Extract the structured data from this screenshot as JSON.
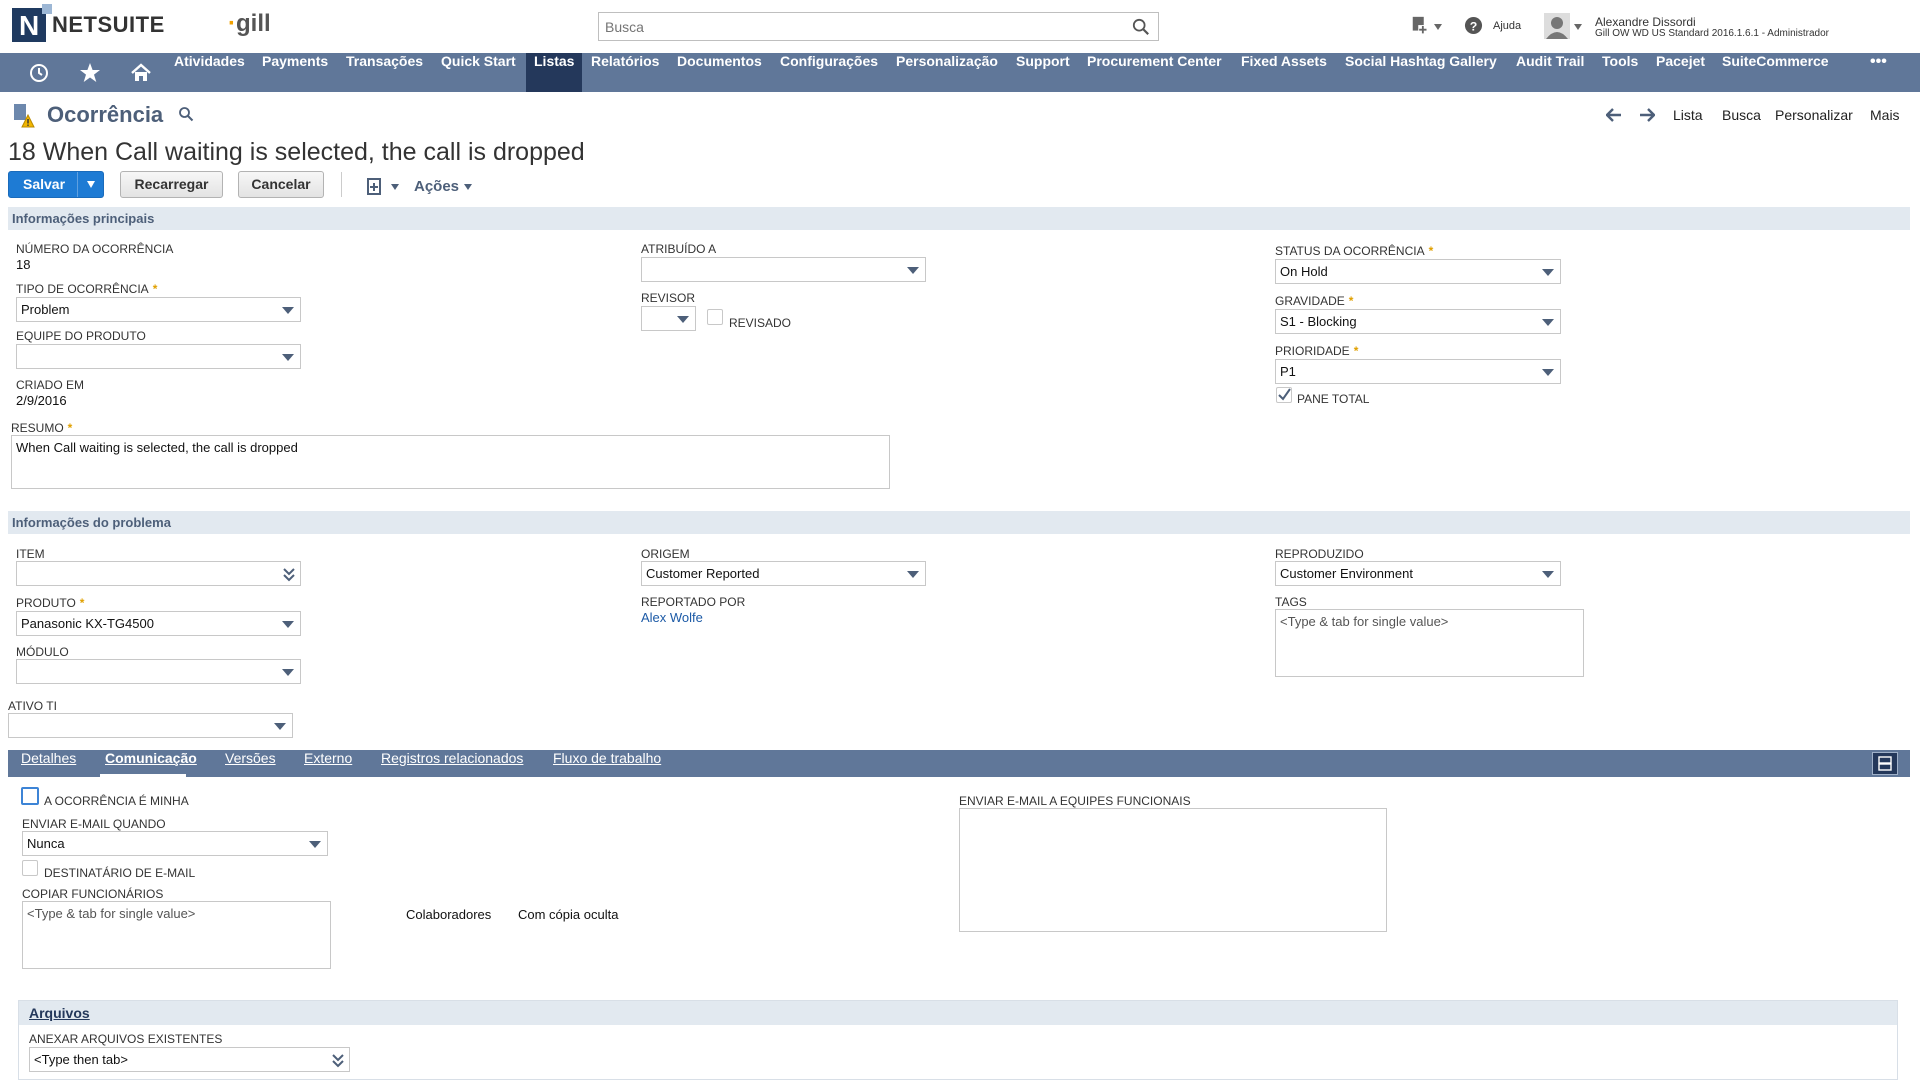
{
  "header": {
    "logo_text": "NETSUITE",
    "brand_text": "gill",
    "search_placeholder": "Busca",
    "help_label": "Ajuda",
    "user_name": "Alexandre Dissordi",
    "user_role": "Gill OW WD US Standard 2016.1.6.1 - Administrador"
  },
  "nav": {
    "items": [
      "Atividades",
      "Payments",
      "Transações",
      "Quick Start",
      "Listas",
      "Relatórios",
      "Documentos",
      "Configurações",
      "Personalização",
      "Support",
      "Procurement Center",
      "Fixed Assets",
      "Social Hashtag Gallery",
      "Audit Trail",
      "Tools",
      "Pacejet",
      "SuiteCommerce"
    ],
    "active": "Listas",
    "more": "•••"
  },
  "page": {
    "title": "Ocorrência",
    "record_title": "18 When Call waiting is selected, the call is dropped",
    "links": [
      "Lista",
      "Busca",
      "Personalizar",
      "Mais"
    ]
  },
  "toolbar": {
    "save": "Salvar",
    "reload": "Recarregar",
    "cancel": "Cancelar",
    "actions": "Ações"
  },
  "primary": {
    "section_title": "Informações principais",
    "numero_label": "NÚMERO DA OCORRÊNCIA",
    "numero_value": "18",
    "tipo_label": "TIPO DE OCORRÊNCIA",
    "tipo_value": "Problem",
    "equipe_label": "EQUIPE DO PRODUTO",
    "equipe_value": "",
    "criado_label": "CRIADO EM",
    "criado_value": "2/9/2016",
    "resumo_label": "RESUMO",
    "resumo_value": "When Call waiting is selected, the call is dropped",
    "atribuido_label": "ATRIBUÍDO A",
    "atribuido_value": "",
    "revisor_label": "REVISOR",
    "revisado_label": "REVISADO",
    "status_label": "STATUS DA OCORRÊNCIA",
    "status_value": "On Hold",
    "gravidade_label": "GRAVIDADE",
    "gravidade_value": "S1 - Blocking",
    "prioridade_label": "PRIORIDADE",
    "prioridade_value": "P1",
    "pane_total_label": "PANE TOTAL",
    "pane_total_checked": true
  },
  "problem": {
    "section_title": "Informações do problema",
    "item_label": "ITEM",
    "item_value": "",
    "produto_label": "PRODUTO",
    "produto_value": "Panasonic KX-TG4500",
    "modulo_label": "MÓDULO",
    "modulo_value": "",
    "ativo_label": "ATIVO TI",
    "ativo_value": "",
    "origem_label": "ORIGEM",
    "origem_value": "Customer Reported",
    "reportado_label": "REPORTADO POR",
    "reportado_value": "Alex Wolfe",
    "reproduzido_label": "REPRODUZIDO",
    "reproduzido_value": "Customer Environment",
    "tags_label": "TAGS",
    "tags_placeholder": "<Type & tab for single value>"
  },
  "subtabs": {
    "items": [
      "Detalhes",
      "Comunicação",
      "Versões",
      "Externo",
      "Registros relacionados",
      "Fluxo de trabalho"
    ],
    "active": "Comunicação"
  },
  "communication": {
    "minha_label": "A OCORRÊNCIA É MINHA",
    "enviar_quando_label": "ENVIAR E-MAIL QUANDO",
    "enviar_quando_value": "Nunca",
    "destinatario_label": "DESTINATÁRIO DE E-MAIL",
    "copiar_label": "COPIAR FUNCIONÁRIOS",
    "copiar_placeholder": "<Type & tab for single value>",
    "colaboradores": "Colaboradores",
    "com_copia_oculta": "Com cópia oculta",
    "enviar_equipes_label": "ENVIAR E-MAIL A EQUIPES FUNCIONAIS"
  },
  "files": {
    "section_title": "Arquivos",
    "anexar_label": "ANEXAR ARQUIVOS EXISTENTES",
    "anexar_placeholder": "<Type then tab>"
  },
  "colors": {
    "nav_bg": "#607799",
    "nav_active": "#24385b",
    "section_bg": "#e2e9f0",
    "primary_button": "#1e7bd4",
    "required_star": "#e0a000"
  }
}
